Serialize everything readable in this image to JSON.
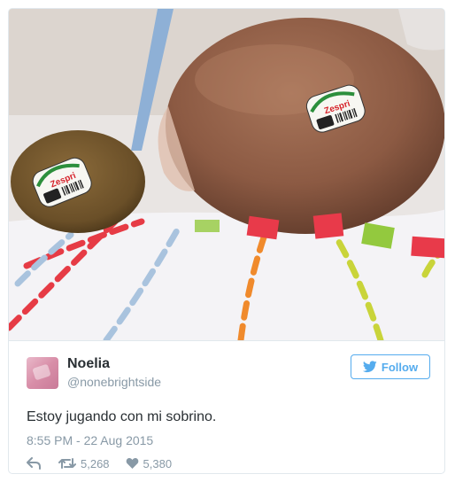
{
  "tweet": {
    "name": "Noelia",
    "handle": "@nonebrightside",
    "text": "Estoy jugando con mi sobrino.",
    "time": "8:55 PM - 22 Aug 2015",
    "follow_label": "Follow",
    "retweets": "5,268",
    "likes": "5,380"
  },
  "photo": {
    "sticker_brand": "Zespri"
  },
  "icons": {
    "reply": "reply-icon",
    "retweet": "retweet-icon",
    "like": "heart-icon",
    "follow": "twitter-bird-icon"
  },
  "colors": {
    "accent": "#55acee",
    "name": "#292f33",
    "muted": "#8899a6"
  }
}
